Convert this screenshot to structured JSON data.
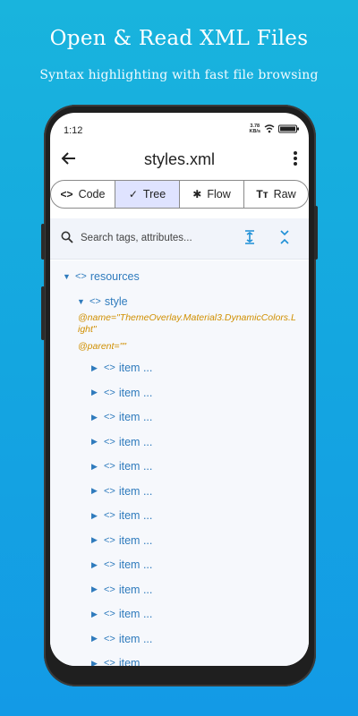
{
  "promo": {
    "headline": "Open & Read XML Files",
    "subline": "Syntax highlighting with fast file browsing"
  },
  "status": {
    "time": "1:12",
    "net_value": "3.78",
    "net_unit": "KB/s",
    "wifi_icon": "wifi-icon",
    "battery_icon": "battery-icon"
  },
  "appbar": {
    "title": "styles.xml",
    "back_icon": "arrow-left-icon",
    "menu_icon": "more-vertical-icon"
  },
  "tabs": [
    {
      "label": "Code",
      "icon": "code-icon",
      "glyph": "<>",
      "active": false
    },
    {
      "label": "Tree",
      "icon": "check-icon",
      "glyph": "✓",
      "active": true
    },
    {
      "label": "Flow",
      "icon": "flow-icon",
      "glyph": "✱",
      "active": false
    },
    {
      "label": "Raw",
      "icon": "text-icon",
      "glyph": "Tт",
      "active": false
    }
  ],
  "search": {
    "placeholder": "Search tags, attributes..."
  },
  "tree": {
    "root_label": "resources",
    "child_label": "style",
    "attr_name": "@name=\"ThemeOverlay.Material3.DynamicColors.L",
    "attr_name_cont": "ight\"",
    "attr_parent": "@parent=\"\"",
    "items": [
      "item ...",
      "item ...",
      "item ...",
      "item ...",
      "item ...",
      "item ...",
      "item ...",
      "item ...",
      "item ...",
      "item ...",
      "item ...",
      "item ...",
      "item"
    ]
  },
  "colors": {
    "background_top": "#19b4dd",
    "background_bottom": "#139ae6",
    "tag": "#2f7bbd",
    "attribute": "#d08f00",
    "active_tab": "#dfe3ff",
    "accent": "#1d8fd6"
  }
}
